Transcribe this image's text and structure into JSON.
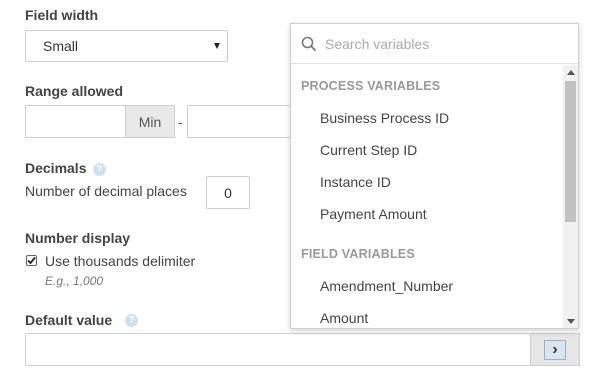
{
  "field_width": {
    "label": "Field width",
    "selected": "Small"
  },
  "range": {
    "label": "Range allowed",
    "min_addon": "Min",
    "separator": "-"
  },
  "decimals": {
    "label": "Decimals",
    "help": "?",
    "places_label": "Number of decimal places",
    "places_value": "0"
  },
  "number_display": {
    "label": "Number display",
    "checkbox_label": "Use thousands delimiter",
    "checked": true,
    "example": "E.g., 1,000"
  },
  "default_value": {
    "label": "Default value",
    "help": "?",
    "button_glyph": "›"
  },
  "variables_dropdown": {
    "search_placeholder": "Search variables",
    "groups": [
      {
        "title": "PROCESS VARIABLES",
        "items": [
          "Business Process ID",
          "Current Step ID",
          "Instance ID",
          "Payment Amount"
        ]
      },
      {
        "title": "FIELD VARIABLES",
        "items": [
          "Amendment_Number",
          "Amount"
        ]
      }
    ]
  },
  "colors": {
    "label_text": "#444444",
    "group_heading": "#999999",
    "help_icon": "#cfe1ee",
    "border": "#cfcfcf"
  }
}
